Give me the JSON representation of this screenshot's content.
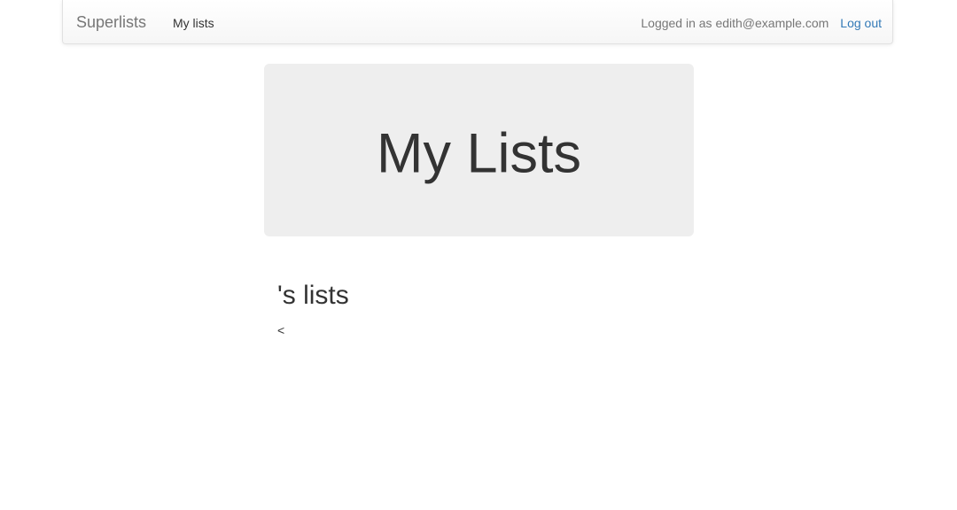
{
  "navbar": {
    "brand": "Superlists",
    "my_lists_link": "My lists",
    "logged_in_text": "Logged in as edith@example.com",
    "logout_link": "Log out"
  },
  "jumbotron": {
    "title": "My Lists"
  },
  "main": {
    "heading": "'s lists",
    "content": "<"
  },
  "colors": {
    "link": "#337ab7",
    "jumbotron_bg": "#eeeeee",
    "muted_text": "#777777",
    "body_text": "#333333"
  }
}
